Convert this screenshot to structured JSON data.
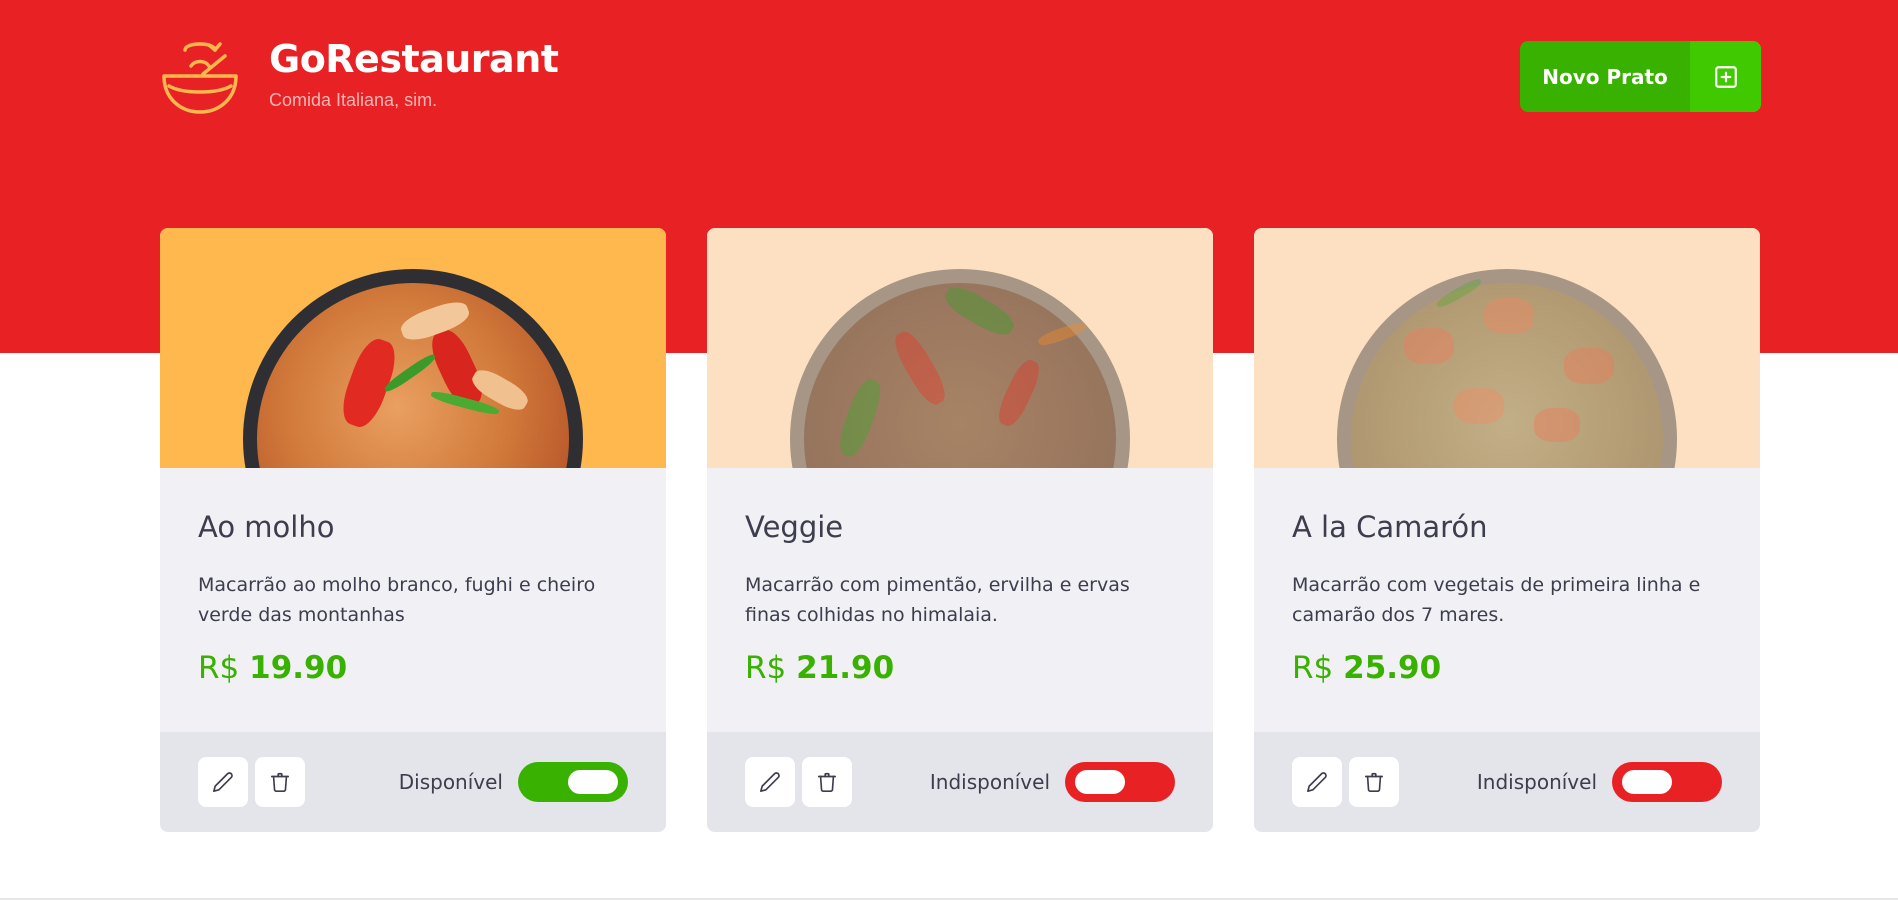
{
  "header": {
    "title": "GoRestaurant",
    "subtitle": "Comida Italiana, sim.",
    "logo_icon": "bowl-icon",
    "new_dish_label": "Novo Prato",
    "new_dish_icon": "plus-square-icon"
  },
  "colors": {
    "brand_red": "#e82224",
    "accent_green": "#39b100",
    "accent_green_light": "#41c900",
    "logo_yellow": "#ffb84d",
    "card_bg": "#f0f0f5",
    "footer_bg": "#e4e4eb"
  },
  "foods": [
    {
      "name": "Ao molho",
      "description": "Macarrão ao molho branco, fughi e cheiro verde das montanhas",
      "currency": "R$",
      "price": "19.90",
      "available": true,
      "status_label": "Disponível",
      "edit_icon": "pencil-icon",
      "delete_icon": "trash-icon"
    },
    {
      "name": "Veggie",
      "description": "Macarrão com pimentão, ervilha e ervas finas colhidas no himalaia.",
      "currency": "R$",
      "price": "21.90",
      "available": false,
      "status_label": "Indisponível",
      "edit_icon": "pencil-icon",
      "delete_icon": "trash-icon"
    },
    {
      "name": "A la Camarón",
      "description": "Macarrão com vegetais de primeira linha e camarão dos 7 mares.",
      "currency": "R$",
      "price": "25.90",
      "available": false,
      "status_label": "Indisponível",
      "edit_icon": "pencil-icon",
      "delete_icon": "trash-icon"
    }
  ]
}
